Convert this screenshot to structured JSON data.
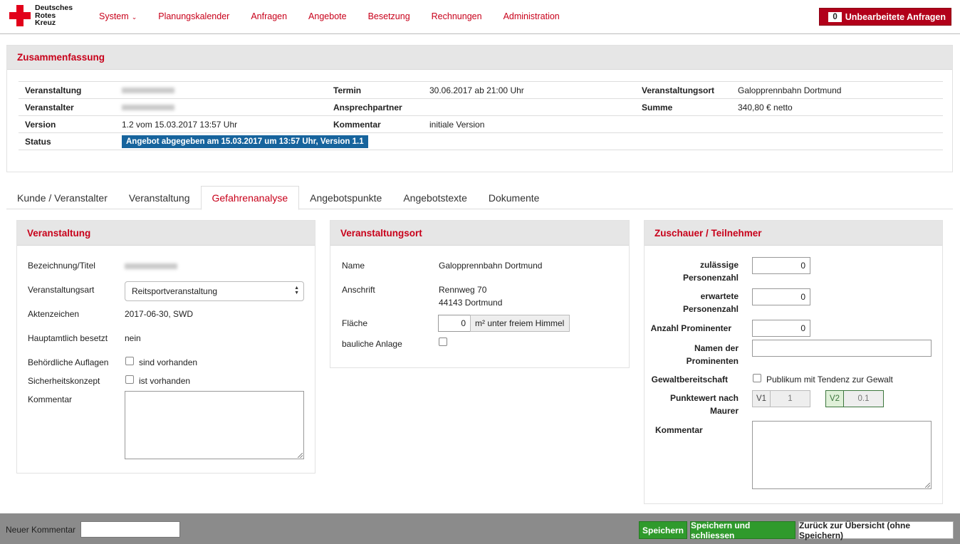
{
  "brand": {
    "line1": "Deutsches",
    "line2": "Rotes",
    "line3": "Kreuz"
  },
  "nav": {
    "items": [
      {
        "label": "System",
        "has_dropdown": true
      },
      {
        "label": "Planungskalender"
      },
      {
        "label": "Anfragen"
      },
      {
        "label": "Angebote"
      },
      {
        "label": "Besetzung"
      },
      {
        "label": "Rechnungen"
      },
      {
        "label": "Administration"
      }
    ],
    "unprocessed": {
      "count": "0",
      "label": "Unbearbeitete Anfragen"
    }
  },
  "summary": {
    "title": "Zusammenfassung",
    "rows": {
      "veranstaltung_label": "Veranstaltung",
      "termin_label": "Termin",
      "termin_value": "30.06.2017 ab 21:00 Uhr",
      "ort_label": "Veranstaltungsort",
      "ort_value": "Galopprennbahn Dortmund",
      "veranstalter_label": "Veranstalter",
      "ansprechpartner_label": "Ansprechpartner",
      "summe_label": "Summe",
      "summe_value": "340,80 € netto",
      "version_label": "Version",
      "version_value": "1.2 vom 15.03.2017 13:57 Uhr",
      "kommentar_label": "Kommentar",
      "kommentar_value": "initiale Version",
      "status_label": "Status",
      "status_value": "Angebot abgegeben am 15.03.2017 um 13:57 Uhr, Version 1.1"
    }
  },
  "tabs": [
    {
      "label": "Kunde / Veranstalter"
    },
    {
      "label": "Veranstaltung"
    },
    {
      "label": "Gefahrenanalyse",
      "active": true
    },
    {
      "label": "Angebotspunkte"
    },
    {
      "label": "Angebotstexte"
    },
    {
      "label": "Dokumente"
    }
  ],
  "veranstaltung": {
    "title": "Veranstaltung",
    "bezeichnung_label": "Bezeichnung/Titel",
    "art_label": "Veranstaltungsart",
    "art_value": "Reitsportveranstaltung",
    "aktenzeichen_label": "Aktenzeichen",
    "aktenzeichen_value": "2017-06-30, SWD",
    "hauptamtlich_label": "Hauptamtlich besetzt",
    "hauptamtlich_value": "nein",
    "auflagen_label": "Behördliche Auflagen",
    "auflagen_check": "sind vorhanden",
    "sicherheit_label": "Sicherheitskonzept",
    "sicherheit_check": "ist vorhanden",
    "kommentar_label": "Kommentar"
  },
  "ort": {
    "title": "Veranstaltungsort",
    "name_label": "Name",
    "name_value": "Galopprennbahn Dortmund",
    "anschrift_label": "Anschrift",
    "anschrift_line1": "Rennweg 70",
    "anschrift_line2": "44143 Dortmund",
    "flaeche_label": "Fläche",
    "flaeche_value": "0",
    "flaeche_unit": "m² unter freiem Himmel",
    "baulich_label": "bauliche Anlage"
  },
  "zuschauer": {
    "title": "Zuschauer / Teilnehmer",
    "zulaessig_label_1": "zulässige",
    "zulaessig_label_2": "Personenzahl",
    "zulaessig_value": "0",
    "erwartet_label_1": "erwartete",
    "erwartet_label_2": "Personenzahl",
    "erwartet_value": "0",
    "prominente_label": "Anzahl Prominenter",
    "prominente_value": "0",
    "namen_label_1": "Namen der",
    "namen_label_2": "Prominenten",
    "gewalt_label": "Gewaltbereitschaft",
    "gewalt_check": "Publikum mit Tendenz zur Gewalt",
    "punkt_label_1": "Punktewert nach",
    "punkt_label_2": "Maurer",
    "v1_label": "V1",
    "v1_value": "1",
    "v2_label": "V2",
    "v2_value": "0.1",
    "kommentar_label": "Kommentar"
  },
  "footer": {
    "neuer_kommentar_label": "Neuer Kommentar",
    "save": "Speichern",
    "save_close": "Speichern und schliessen",
    "back": "Zurück zur Übersicht (ohne Speichern)"
  }
}
